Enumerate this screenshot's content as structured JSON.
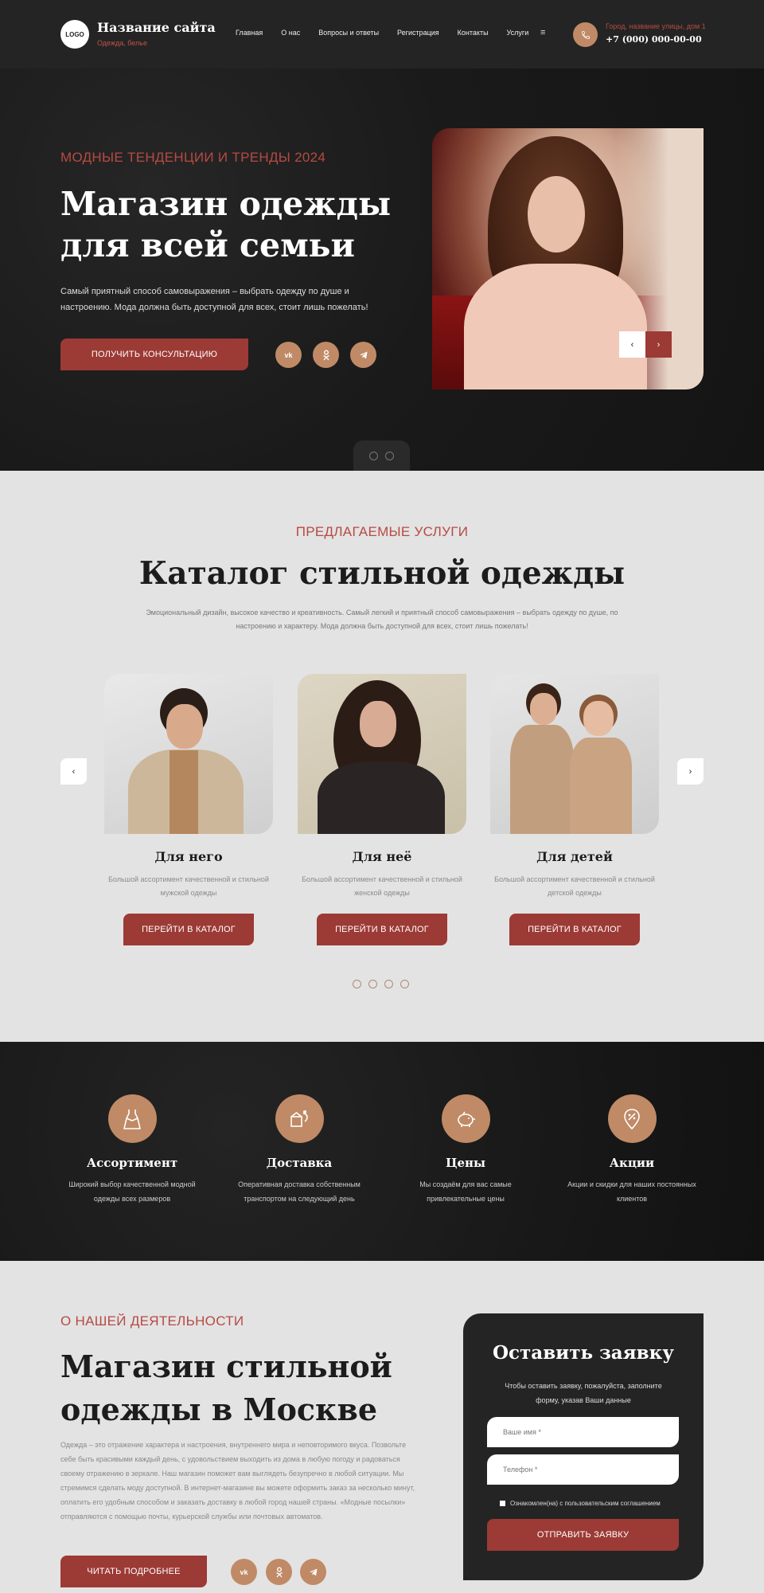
{
  "header": {
    "logo": "LOGO",
    "site_name": "Название сайта",
    "tagline": "Одежда, белье",
    "nav": [
      "Главная",
      "О нас",
      "Вопросы и ответы",
      "Регистрация",
      "Контакты",
      "Услуги"
    ],
    "menu_icon": "≡",
    "address": "Город, название улицы, дом 1",
    "phone": "+7 (000) 000-00-00"
  },
  "hero": {
    "subtitle": "МОДНЫЕ ТЕНДЕНЦИИ И ТРЕНДЫ 2024",
    "title": "Магазин одежды для всей семьи",
    "text": "Самый приятный способ самовыражения – выбрать одежду по душе и настроению. Мода должна быть доступной для всех, стоит лишь пожелать!",
    "button": "ПОЛУЧИТЬ КОНСУЛЬТАЦИЮ",
    "social": [
      "vk",
      "ok",
      "telegram"
    ],
    "prev": "‹",
    "next": "›"
  },
  "catalog": {
    "subtitle": "ПРЕДЛАГАЕМЫЕ УСЛУГИ",
    "title": "Каталог стильной одежды",
    "text": "Эмоциональный дизайн, высокое качество и креативность. Самый легкий и приятный способ самовыражения – выбрать одежду по душе, по настроению и характеру. Мода должна быть доступной для всех, стоит лишь пожелать!",
    "prev": "‹",
    "next": "›",
    "cards": [
      {
        "title": "Для него",
        "text": "Большой ассортимент качественной и стильной мужской одежды",
        "button": "ПЕРЕЙТИ В КАТАЛОГ"
      },
      {
        "title": "Для неё",
        "text": "Большой ассортимент качественной и стильной женской одежды",
        "button": "ПЕРЕЙТИ В КАТАЛОГ"
      },
      {
        "title": "Для детей",
        "text": "Большой ассортимент качественной и стильной детской одежды",
        "button": "ПЕРЕЙТИ В КАТАЛОГ"
      }
    ]
  },
  "features": [
    {
      "icon": "dress-icon",
      "title": "Ассортимент",
      "text": "Широкий выбор качественной модной одежды всех размеров"
    },
    {
      "icon": "delivery-icon",
      "title": "Доставка",
      "text": "Оперативная доставка собственным транспортом на следующий день"
    },
    {
      "icon": "piggy-bank-icon",
      "title": "Цены",
      "text": "Мы создаём для вас самые привлекательные цены"
    },
    {
      "icon": "discount-tag-icon",
      "title": "Акции",
      "text": "Акции и скидки для наших постоянных клиентов"
    }
  ],
  "about": {
    "subtitle": "О НАШЕЙ ДЕЯТЕЛЬНОСТИ",
    "title": "Магазин стильной одежды в Москве",
    "text": "Одежда – это отражение характера и настроения, внутреннего мира и неповторимого вкуса. Позвольте себе быть красивыми каждый день, с удовольствием выходить из дома в любую погоду и радоваться своему отражению в зеркале. Наш магазин поможет вам выглядеть безупречно в любой ситуации. Мы стремимся сделать моду доступной. В интернет-магазине вы можете оформить заказ за несколько минут, оплатить его удобным способом и заказать доставку в любой город нашей страны. «Модные посылки» отправляются с помощью почты, курьерской службы или почтовых автоматов.",
    "button": "ЧИТАТЬ ПОДРОБНЕЕ"
  },
  "form": {
    "title": "Оставить заявку",
    "text": "Чтобы оставить заявку, пожалуйста, заполните форму, указав Ваши данные",
    "name_placeholder": "Ваше имя *",
    "phone_placeholder": "Телефон *",
    "agreement": "Ознакомлен(на) с пользовательским соглашением",
    "button": "ОТПРАВИТЬ ЗАЯВКУ"
  },
  "colors": {
    "accent_red": "#9c3a35",
    "accent_text_red": "#b74a43",
    "accent_tan": "#c08a66",
    "dark": "#1c1c1c",
    "light": "#e3e3e3"
  }
}
